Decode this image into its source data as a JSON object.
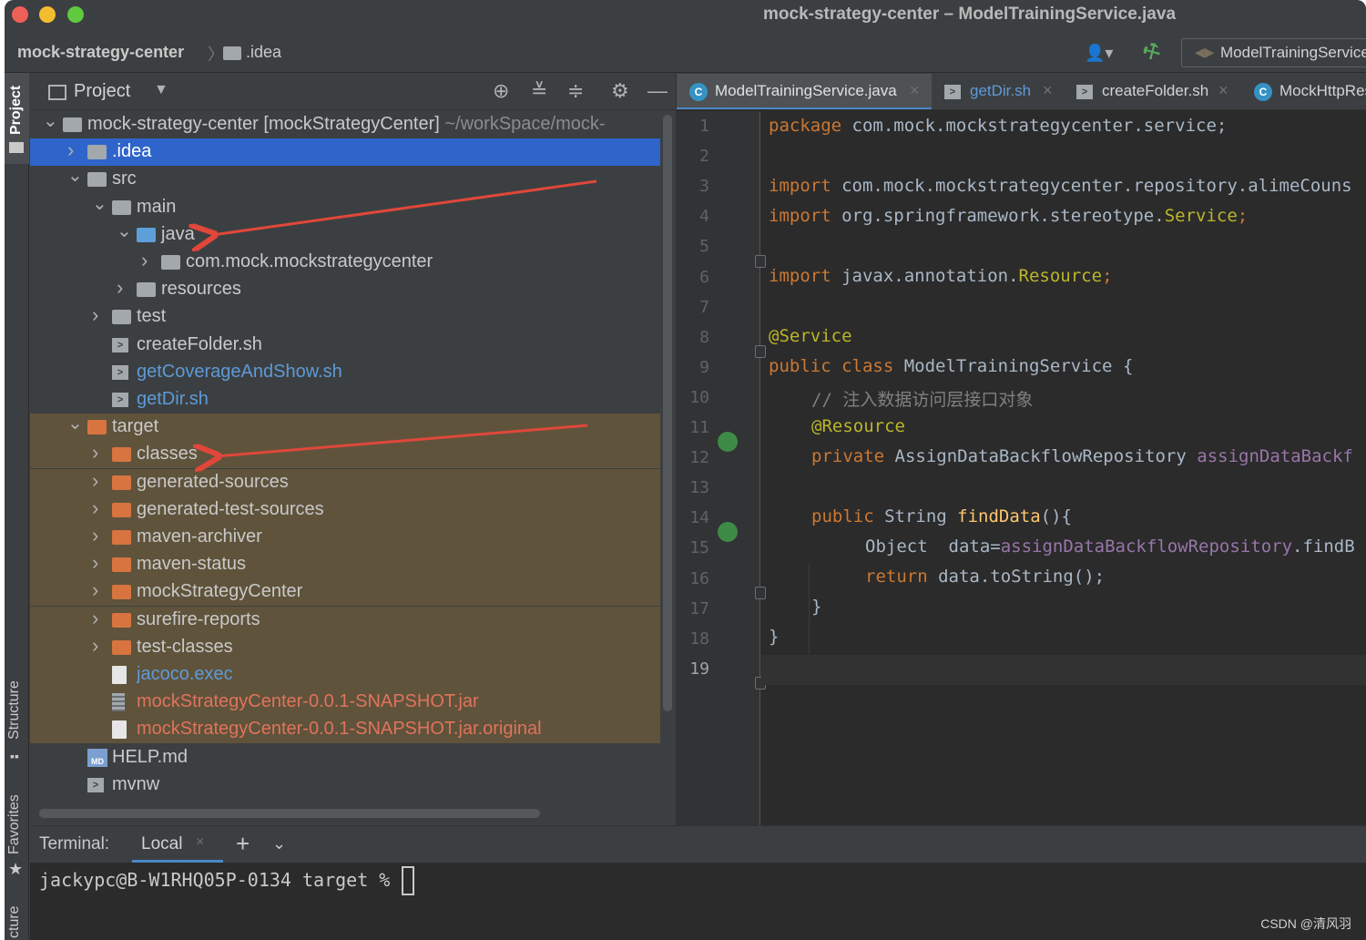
{
  "window": {
    "title": "mock-strategy-center – ModelTrainingService.java"
  },
  "navbar": {
    "breadcrumb_root": "mock-strategy-center",
    "breadcrumb_child": ".idea",
    "run_config": "ModelTrainingService"
  },
  "left_strip": {
    "project": "Project",
    "structure": "Structure",
    "favorites": "Favorites",
    "bottom": "cture"
  },
  "project_panel": {
    "title": "Project",
    "tree": [
      {
        "label": "mock-strategy-center [mockStrategyCenter]",
        "extra": " ~/workSpace/mock-",
        "chevron": "v",
        "depth": 0,
        "icon": "module-folder"
      },
      {
        "label": ".idea",
        "chevron": ">",
        "depth": 1,
        "icon": "folder"
      },
      {
        "label": "src",
        "chevron": "v",
        "depth": 1,
        "icon": "folder"
      },
      {
        "label": "main",
        "chevron": "v",
        "depth": 2,
        "icon": "folder"
      },
      {
        "label": "java",
        "chevron": "v",
        "depth": 3,
        "icon": "source-folder"
      },
      {
        "label": "com.mock.mockstrategycenter",
        "chevron": ">",
        "depth": 4,
        "icon": "package"
      },
      {
        "label": "resources",
        "chevron": ">",
        "depth": 3,
        "icon": "resources-folder"
      },
      {
        "label": "test",
        "chevron": ">",
        "depth": 2,
        "icon": "folder"
      },
      {
        "label": "createFolder.sh",
        "depth": 2,
        "icon": "shell-file"
      },
      {
        "label": "getCoverageAndShow.sh",
        "depth": 2,
        "icon": "shell-file"
      },
      {
        "label": "getDir.sh",
        "depth": 2,
        "icon": "shell-file"
      },
      {
        "label": "target",
        "chevron": "v",
        "depth": 1,
        "icon": "excluded-folder"
      },
      {
        "label": "classes",
        "chevron": ">",
        "depth": 2,
        "icon": "excluded-folder"
      },
      {
        "label": "generated-sources",
        "chevron": ">",
        "depth": 2,
        "icon": "excluded-folder"
      },
      {
        "label": "generated-test-sources",
        "chevron": ">",
        "depth": 2,
        "icon": "excluded-folder"
      },
      {
        "label": "maven-archiver",
        "chevron": ">",
        "depth": 2,
        "icon": "excluded-folder"
      },
      {
        "label": "maven-status",
        "chevron": ">",
        "depth": 2,
        "icon": "excluded-folder"
      },
      {
        "label": "mockStrategyCenter",
        "chevron": ">",
        "depth": 2,
        "icon": "excluded-folder"
      },
      {
        "label": "surefire-reports",
        "chevron": ">",
        "depth": 2,
        "icon": "excluded-folder"
      },
      {
        "label": "test-classes",
        "chevron": ">",
        "depth": 2,
        "icon": "excluded-folder"
      },
      {
        "label": "jacoco.exec",
        "depth": 2,
        "icon": "file"
      },
      {
        "label": "mockStrategyCenter-0.0.1-SNAPSHOT.jar",
        "depth": 2,
        "icon": "jar-file"
      },
      {
        "label": "mockStrategyCenter-0.0.1-SNAPSHOT.jar.original",
        "depth": 2,
        "icon": "file"
      },
      {
        "label": "HELP.md",
        "depth": 1,
        "icon": "markdown-file"
      },
      {
        "label": "mvnw",
        "depth": 1,
        "icon": "shell-file"
      }
    ]
  },
  "editor": {
    "tabs": [
      {
        "label": "ModelTrainingService.java",
        "icon": "java-class-icon"
      },
      {
        "label": "getDir.sh",
        "icon": "shell-file-icon"
      },
      {
        "label": "createFolder.sh",
        "icon": "shell-file-icon"
      },
      {
        "label": "MockHttpRes",
        "icon": "java-class-icon"
      }
    ],
    "line_numbers": [
      "1",
      "2",
      "3",
      "4",
      "5",
      "6",
      "7",
      "8",
      "9",
      "10",
      "11",
      "12",
      "13",
      "14",
      "15",
      "16",
      "17",
      "18",
      "19"
    ],
    "current_line": "19",
    "code": {
      "l1_kw": "package",
      "l1_rest": " com.mock.mockstrategycenter.service;",
      "l3_kw": "import",
      "l3_rest": " com.mock.mockstrategycenter.repository.alimeCouns",
      "l4_kw": "import",
      "l4_rest": " org.springframework.stereotype.",
      "l4_ann": "Service",
      "l4_end": ";",
      "l6_kw": "import",
      "l6_rest": " javax.annotation.",
      "l6_ann": "Resource",
      "l6_end": ";",
      "l8_ann": "@Service",
      "l9_kw": "public class",
      "l9_rest": " ModelTrainingService {",
      "l10_cmt": "// 注入数据访问层接口对象",
      "l11_ann": "@Resource",
      "l12_kw": "private",
      "l12_rest": " AssignDataBackflowRepository ",
      "l12_fld": "assignDataBackf",
      "l14_kw": "public",
      "l14_rest": " String ",
      "l14_fn": "findData",
      "l14_end": "(){",
      "l15_rest": "Object  data=",
      "l15_fld": "assignDataBackflowRepository",
      "l15_end": ".findB",
      "l16_kw": "return",
      "l16_rest": " data.toString();",
      "l17": "}",
      "l18": "}"
    }
  },
  "terminal": {
    "title": "Terminal:",
    "tab": "Local",
    "prompt": "jackypc@B-W1RHQ05P-0134 target % "
  },
  "watermark": "CSDN @清风羽",
  "colors": {
    "selection": "#2f65ca",
    "excluded_bg": "#5f533b",
    "arrow": "#e0473a",
    "keyword": "#cc7832",
    "annotation": "#bbb529"
  }
}
